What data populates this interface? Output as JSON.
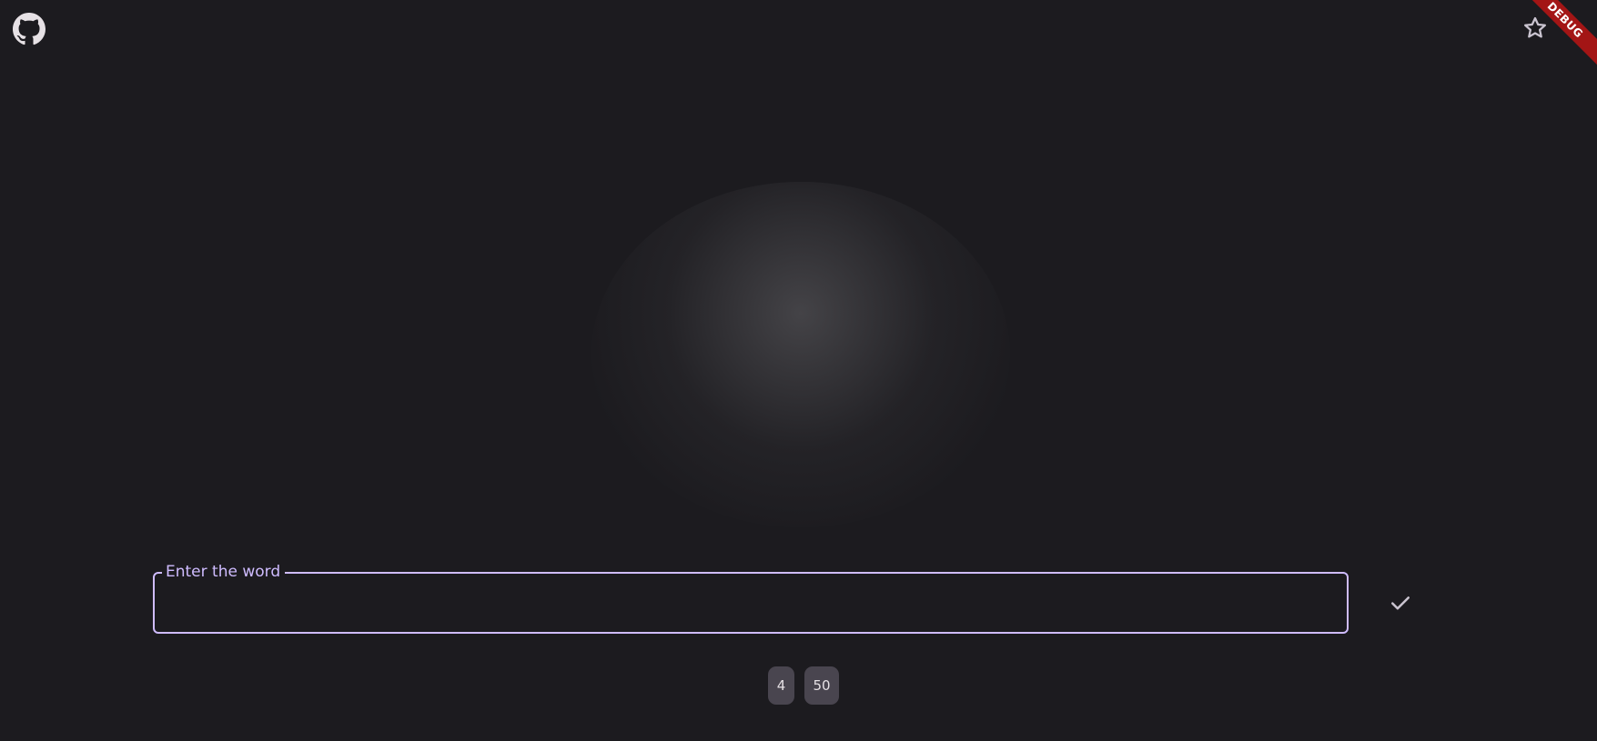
{
  "header": {
    "github_icon": "github-icon",
    "star_icon": "star-outline-icon",
    "debug_banner": "DEBUG"
  },
  "input": {
    "label": "Enter the word",
    "value": "",
    "submit_icon": "check-icon"
  },
  "chips": [
    {
      "label": "4"
    },
    {
      "label": "50"
    }
  ],
  "colors": {
    "background": "#1c1b1f",
    "accent": "#cfbcff",
    "chip_background": "#49454f",
    "debug_ribbon": "#a31515"
  }
}
